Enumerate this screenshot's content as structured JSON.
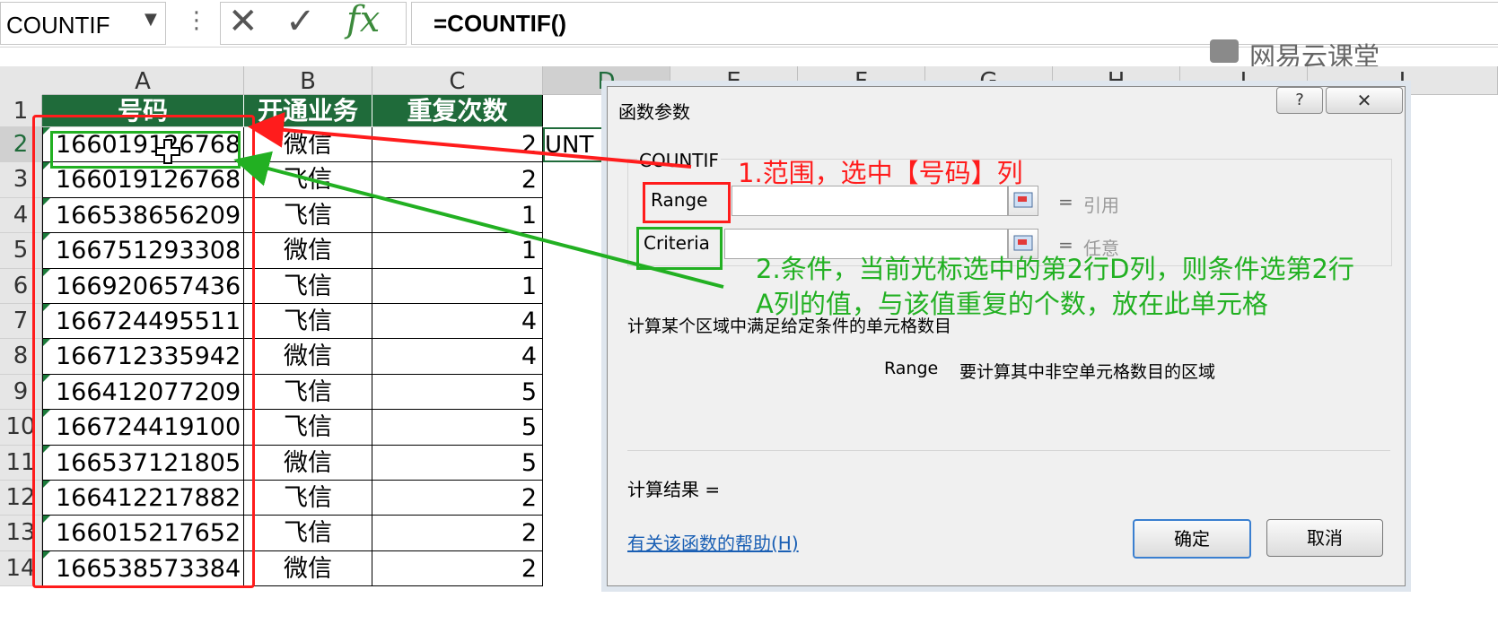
{
  "formula_bar": {
    "name_box": "COUNTIF",
    "cancel_icon": "✕",
    "enter_icon": "✓",
    "fx_icon": "fx",
    "formula": "=COUNTIF()"
  },
  "watermark": "网易云课堂",
  "columns": [
    "A",
    "B",
    "C",
    "D",
    "E",
    "F",
    "G",
    "H",
    "I",
    "J"
  ],
  "sheet": {
    "header_row": {
      "row": "1",
      "a": "号码",
      "b": "开通业务",
      "c": "重复次数"
    },
    "d2_overflow": "UNT",
    "rows": [
      {
        "row": "2",
        "a": "166019126768",
        "b": "微信",
        "c": "2"
      },
      {
        "row": "3",
        "a": "166019126768",
        "b": "飞信",
        "c": "2"
      },
      {
        "row": "4",
        "a": "166538656209",
        "b": "飞信",
        "c": "1"
      },
      {
        "row": "5",
        "a": "166751293308",
        "b": "微信",
        "c": "1"
      },
      {
        "row": "6",
        "a": "166920657436",
        "b": "飞信",
        "c": "1"
      },
      {
        "row": "7",
        "a": "166724495511",
        "b": "飞信",
        "c": "4"
      },
      {
        "row": "8",
        "a": "166712335942",
        "b": "微信",
        "c": "4"
      },
      {
        "row": "9",
        "a": "166412077209",
        "b": "飞信",
        "c": "5"
      },
      {
        "row": "10",
        "a": "166724419100",
        "b": "飞信",
        "c": "5"
      },
      {
        "row": "11",
        "a": "166537121805",
        "b": "微信",
        "c": "5"
      },
      {
        "row": "12",
        "a": "166412217882",
        "b": "飞信",
        "c": "2"
      },
      {
        "row": "13",
        "a": "166015217652",
        "b": "飞信",
        "c": "2"
      },
      {
        "row": "14",
        "a": "166538573384",
        "b": "微信",
        "c": "2"
      }
    ]
  },
  "dialog": {
    "title": "函数参数",
    "help_icon": "?",
    "close_icon": "✕",
    "function_name": "COUNTIF",
    "args": [
      {
        "label": "Range",
        "eq": "=",
        "hint": "引用"
      },
      {
        "label": "Criteria",
        "eq": "=",
        "hint": "任意"
      }
    ],
    "description": "计算某个区域中满足给定条件的单元格数目",
    "arg_desc_name": "Range",
    "arg_desc_text": "要计算其中非空单元格数目的区域",
    "result_label": "计算结果 =",
    "help_link": "有关该函数的帮助(H)",
    "ok_label": "确定",
    "cancel_label": "取消"
  },
  "annotations": {
    "step1": "1.范围，选中【号码】列",
    "step2_line1": "2.条件，当前光标选中的第2行D列，则条件选第2行",
    "step2_line2": "A列的值，与该值重复的个数，放在此单元格",
    "red_color": "#ff1c1c",
    "green_color": "#22b022"
  }
}
